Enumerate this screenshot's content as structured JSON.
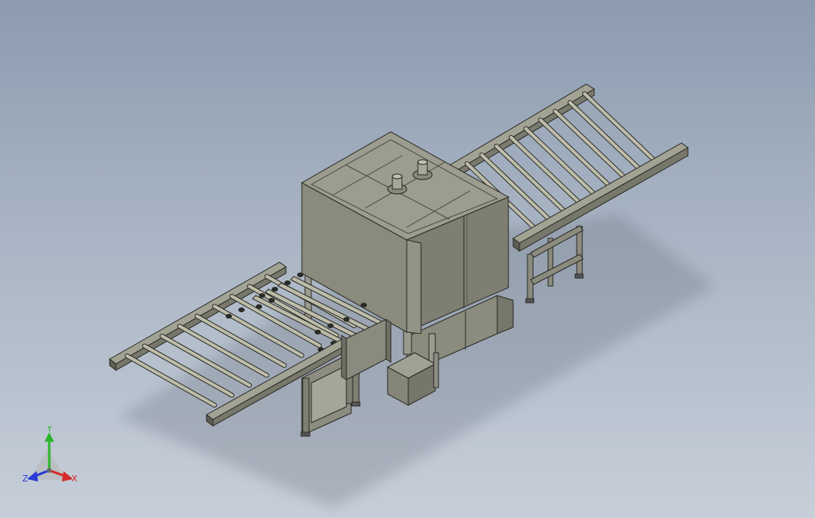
{
  "colors": {
    "background_top": "#8c9bb0",
    "background_bottom": "#c6ced8",
    "machine_body": "#8b8b7e",
    "machine_body_dark": "#6e6e63",
    "machine_top": "#9c9c90",
    "frame_edge": "#2a2a26",
    "roller": "#b9b8a6",
    "axis_x": "#d62a2a",
    "axis_y": "#2bb52b",
    "axis_z": "#2a3bd6"
  },
  "triad": {
    "x_label": "X",
    "y_label": "Y",
    "z_label": "Z"
  }
}
